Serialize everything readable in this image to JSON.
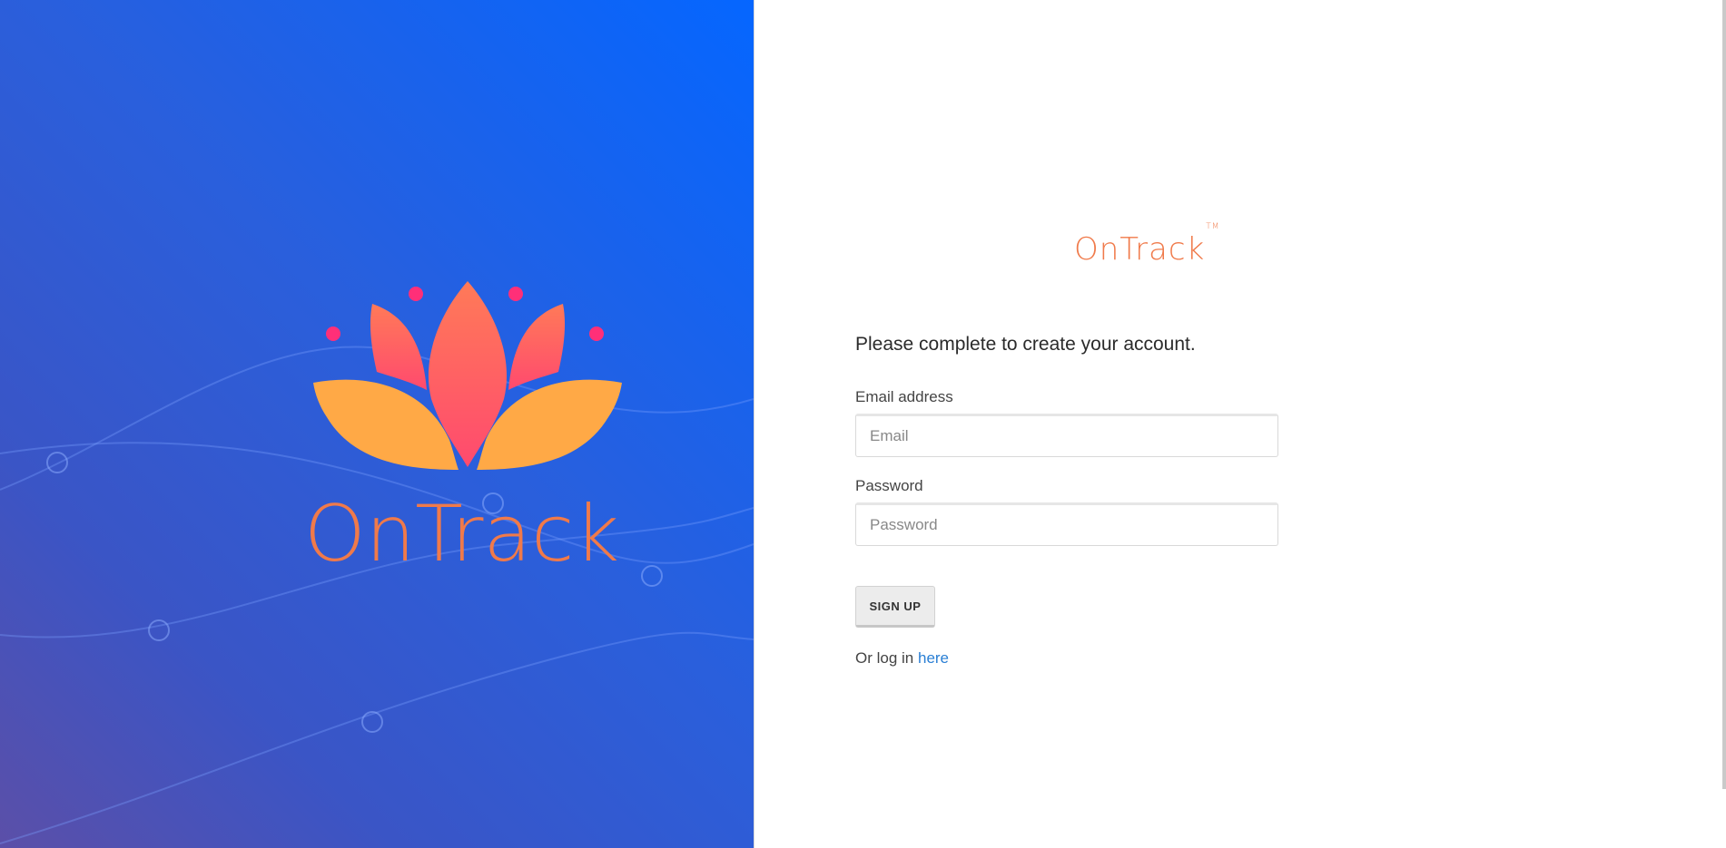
{
  "brand": {
    "name": "OnTrack",
    "trademark": "TM",
    "colors": {
      "orange": "#f07a4a",
      "petal_pink": "#ff4f70",
      "petal_gold": "#ffa946",
      "dot": "#ff2f78",
      "panel_blue": "#0566ff"
    }
  },
  "form": {
    "heading": "Please complete to create your account.",
    "email": {
      "label": "Email address",
      "placeholder": "Email",
      "value": ""
    },
    "password": {
      "label": "Password",
      "placeholder": "Password",
      "value": ""
    },
    "submit_label": "SIGN UP"
  },
  "login": {
    "prefix": "Or log in",
    "link_label": "here"
  }
}
